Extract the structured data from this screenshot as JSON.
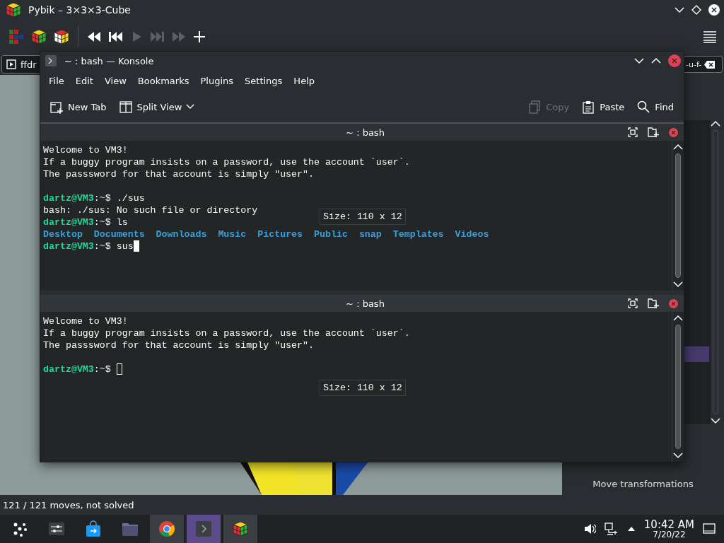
{
  "pybik": {
    "title": "Pybik – 3×3×3-Cube",
    "toolbar": [
      {
        "kind": "cube-flat"
      },
      {
        "kind": "cube"
      },
      {
        "kind": "cube-scrambled"
      },
      {
        "kind": "rewind",
        "disabled": false
      },
      {
        "kind": "previous",
        "disabled": false
      },
      {
        "kind": "play",
        "disabled": true
      },
      {
        "kind": "next",
        "disabled": true
      },
      {
        "kind": "forward",
        "disabled": true
      },
      {
        "kind": "add",
        "disabled": false
      }
    ],
    "tabs": [
      {
        "label": "ffdr"
      },
      {
        "label": "-u-f-"
      }
    ],
    "side_panel": {
      "items": [
        {
          "label": "Move transformations"
        }
      ]
    },
    "status": "121 / 121 moves, not solved"
  },
  "konsole": {
    "title": "~ : bash — Konsole",
    "menu": [
      "File",
      "Edit",
      "View",
      "Bookmarks",
      "Plugins",
      "Settings",
      "Help"
    ],
    "toolbar": [
      {
        "kind": "new-tab",
        "label": "New Tab",
        "disabled": false
      },
      {
        "kind": "split-view",
        "label": "Split View",
        "disabled": false
      },
      {
        "kind": "copy",
        "label": "Copy",
        "disabled": true
      },
      {
        "kind": "paste",
        "label": "Paste",
        "disabled": false
      },
      {
        "kind": "find",
        "label": "Find",
        "disabled": false
      }
    ],
    "panes": [
      {
        "title": "~ : bash",
        "focused": true,
        "overlay": "Size: 110 x 12",
        "blocks": [
          {
            "lines": [
              [
                {
                  "kind": "plain",
                  "text": "Welcome to VM3!"
                }
              ],
              [
                {
                  "kind": "plain",
                  "text": "If a buggy program insists on a password, use the account `user`."
                }
              ],
              [
                {
                  "kind": "plain",
                  "text": "The passsword for that account is simply \"user\"."
                }
              ]
            ]
          },
          {
            "lines": [
              [
                {
                  "kind": "user",
                  "text": "dartz@VM3"
                },
                {
                  "kind": "plain",
                  "text": ":"
                },
                {
                  "kind": "path",
                  "text": "~"
                },
                {
                  "kind": "plain",
                  "text": "$ ./sus"
                }
              ],
              [
                {
                  "kind": "plain",
                  "text": "bash: ./sus: No such file or directory"
                }
              ],
              [
                {
                  "kind": "user",
                  "text": "dartz@VM3"
                },
                {
                  "kind": "plain",
                  "text": ":"
                },
                {
                  "kind": "path",
                  "text": "~"
                },
                {
                  "kind": "plain",
                  "text": "$ ls"
                }
              ],
              [
                {
                  "kind": "dir",
                  "text": "Desktop"
                },
                {
                  "kind": "dir",
                  "text": "Documents"
                },
                {
                  "kind": "dir",
                  "text": "Downloads"
                },
                {
                  "kind": "dir",
                  "text": "Music"
                },
                {
                  "kind": "dir",
                  "text": "Pictures"
                },
                {
                  "kind": "dir",
                  "text": "Public"
                },
                {
                  "kind": "dir",
                  "text": "snap"
                },
                {
                  "kind": "dir",
                  "text": "Templates"
                },
                {
                  "kind": "dir",
                  "text": "Videos"
                }
              ],
              [
                {
                  "kind": "user",
                  "text": "dartz@VM3"
                },
                {
                  "kind": "plain",
                  "text": ":"
                },
                {
                  "kind": "path",
                  "text": "~"
                },
                {
                  "kind": "plain",
                  "text": "$ sus"
                },
                {
                  "kind": "cursor"
                }
              ]
            ]
          }
        ]
      },
      {
        "title": "~ : bash",
        "focused": false,
        "overlay": "Size: 110 x 12",
        "blocks": [
          {
            "lines": [
              [
                {
                  "kind": "plain",
                  "text": "Welcome to VM3!"
                }
              ],
              [
                {
                  "kind": "plain",
                  "text": "If a buggy program insists on a password, use the account `user`."
                }
              ],
              [
                {
                  "kind": "plain",
                  "text": "The passsword for that account is simply \"user\"."
                }
              ]
            ]
          },
          {
            "lines": [
              [
                {
                  "kind": "user",
                  "text": "dartz@VM3"
                },
                {
                  "kind": "plain",
                  "text": ":"
                },
                {
                  "kind": "path",
                  "text": "~"
                },
                {
                  "kind": "plain",
                  "text": "$ "
                },
                {
                  "kind": "cursor"
                }
              ]
            ]
          }
        ]
      }
    ]
  },
  "taskbar": {
    "items": [
      {
        "kind": "launcher",
        "open": false,
        "active": false
      },
      {
        "kind": "settings",
        "open": false,
        "active": false
      },
      {
        "kind": "store",
        "open": false,
        "active": false
      },
      {
        "kind": "folder",
        "open": false,
        "active": false
      },
      {
        "kind": "browser",
        "open": true,
        "active": false
      },
      {
        "kind": "terminal",
        "open": true,
        "active": true
      },
      {
        "kind": "cube",
        "open": true,
        "active": false
      }
    ],
    "time": "10:42 AM",
    "date": "7/20/22"
  }
}
